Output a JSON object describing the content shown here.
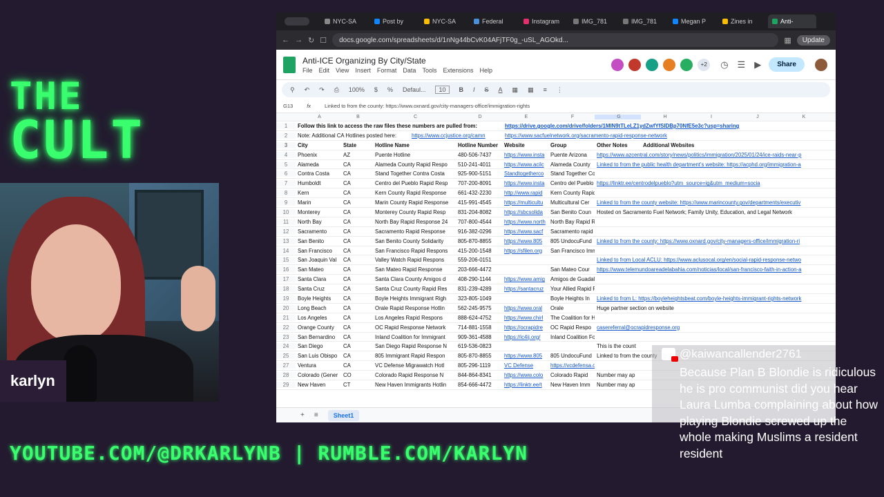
{
  "overlay": {
    "title_line1": "THE",
    "title_line2": "CULT",
    "streamer_name": "karlyn",
    "footer": "YOUTUBE.COM/@DRKARLYNB | RUMBLE.COM/KARLYN",
    "accent_color": "#39ff6e"
  },
  "browser": {
    "tabs": [
      "NYC-SA",
      "Post by",
      "NYC-SA",
      "Federal",
      "Instagram",
      "IMG_781",
      "IMG_781",
      "Megan P",
      "Zines in",
      "Anti-"
    ],
    "url": "docs.google.com/spreadsheets/d/1nNg44bCvK04AFjTF0g_-uSL_AGOkd...",
    "update_label": "Update"
  },
  "sheet": {
    "doc_title": "Anti-ICE Organizing By City/State",
    "menus": [
      "File",
      "Edit",
      "View",
      "Insert",
      "Format",
      "Data",
      "Tools",
      "Extensions",
      "Help"
    ],
    "share_label": "Share",
    "avatar_more": "+2",
    "zoom": "100%",
    "font": "Defaul...",
    "font_size": "10",
    "cell_ref": "G13",
    "formula": "Linked to from the county: https://www.oxnard.gov/city-managers-office/immigration-rights",
    "columns": [
      "A",
      "B",
      "C",
      "D",
      "E",
      "F",
      "G",
      "H",
      "I",
      "J",
      "K"
    ],
    "row1_text": "Follow this link to access the raw files these numbers are pulled from:",
    "row1_link": "https://drive.google.com/drive/folders/1MlN9tTLeLZ1ydZwfYfSIDBp70NfE5e3c?usp=sharing",
    "row2_text": "Note: Additional CA Hotlines posted here:",
    "row2_link1": "https://www.ccjustice.org/camn",
    "row2_link2": "https://www.sacfuelnetwork.org/sacramento-rapid-response-network",
    "headers": [
      "City",
      "State",
      "Hotline Name",
      "Hotline Number",
      "Website",
      "Group",
      "Other Notes",
      "Additional Websites"
    ],
    "rows": [
      [
        "4",
        "Phoenix",
        "AZ",
        "Puente Hotline",
        "480-506-7437",
        "https://www.insta",
        "Puente Arizona",
        "https://www.azcentral.com/story/news/politics/immigration/2025/01/24/ice-raids-near-p"
      ],
      [
        "5",
        "Alameda",
        "CA",
        "Alameda County Rapid Respo",
        "510-241-4011",
        "https://www.acilc",
        "Alameda County",
        "Linked to from the public health department's website: https://acphd.org/immigration-a"
      ],
      [
        "6",
        "Contra Costa",
        "CA",
        "Stand Together Contra Costa",
        "925-900-5151",
        "Standtogetherco",
        "Stand Together Costa County Public Defenders",
        ""
      ],
      [
        "7",
        "Humboldt",
        "CA",
        "Centro del Pueblo Rapid Resp",
        "707-200-8091",
        "https://www.insta",
        "Centro del Pueblo Rapid Respon",
        "https://linktr.ee/centrodelpueblo?utm_source=ig&utm_medium=socia"
      ],
      [
        "8",
        "Kern",
        "CA",
        "Kern County Rapid Response",
        "661-432-2230",
        "http://www.rapid",
        "Kern County Rapid Response Network of Kern",
        ""
      ],
      [
        "9",
        "Marin",
        "CA",
        "Marin County Rapid Response",
        "415-991-4545",
        "https://multicultu",
        "Multicultural Cer",
        "Linked to from the county website: https://www.marincounty.gov/departments/executiv"
      ],
      [
        "10",
        "Monterey",
        "CA",
        "Monterey County Rapid Resp",
        "831-204-8082",
        "https://sbcsolida",
        "San Benito Coun",
        "Hosted on Sacramento Fuel Network; Family Unity, Education, and Legal Network"
      ],
      [
        "11",
        "North Bay",
        "CA",
        "North Bay Rapid Response 24",
        "707-800-4544",
        "https://www.north",
        "North Bay Rapid Response Network",
        ""
      ],
      [
        "12",
        "Sacramento",
        "CA",
        "Sacramento Rapid Response",
        "916-382-0296",
        "https://www.sacf",
        "Sacramento rapid response network",
        ""
      ],
      [
        "13",
        "San Benito",
        "CA",
        "San Benito County Solidarity",
        "805-870-8855",
        "https://www.805",
        "805 UndocuFund",
        "Linked to from the county: https://www.oxnard.gov/city-managers-office/immigration-ri"
      ],
      [
        "14",
        "San Francisco",
        "CA",
        "San Francisco Rapid Respons",
        "415-200-1548",
        "https://sfilen.org",
        "San Francisco Immigrant Legal & Education Network",
        ""
      ],
      [
        "15",
        "San Joaquin Val",
        "CA",
        "Valley Watch Rapid Respons",
        "559-206-0151",
        "",
        "",
        "Linked to from Local ACLU: https://www.aclusocal.org/en/social-rapid-response-netwo"
      ],
      [
        "16",
        "San Mateo",
        "CA",
        "San Mateo Rapid Response",
        "203-666-4472",
        "",
        "San Mateo Cour",
        "https://www.telemundoareadelabahia.com/noticias/local/san-francisco-faith-in-action-a"
      ],
      [
        "17",
        "Santa Clara",
        "CA",
        "Santa Clara County Amigos d",
        "408-290-1144",
        "https://www.amig",
        "Amigos de Guadalupe Center for Justice & Empowerment",
        ""
      ],
      [
        "18",
        "Santa Cruz",
        "CA",
        "Santa Cruz County Rapid Res",
        "831-239-4289",
        "https://santacruz",
        "Your Allied Rapid Response for Santa Cruz County",
        ""
      ],
      [
        "19",
        "Boyle Heights",
        "CA",
        "Boyle Heights Immigrant Righ",
        "323-805-1049",
        "",
        "Boyle Heights In",
        "Linked to from L: https://boyleheightsbeat.com/boyle-heights-immigrant-rights-network"
      ],
      [
        "20",
        "Long Beach",
        "CA",
        "Orale Rapid Response Hotlin",
        "562-245-9575",
        "https://www.oral",
        "Orale",
        "Huge partner section on website"
      ],
      [
        "21",
        "Los Angeles",
        "CA",
        "Los Angeles Rapid Respons",
        "888-624-4752",
        "https://www.chirl",
        "The Coalition for Humane Immigrant Rights",
        ""
      ],
      [
        "22",
        "Orange County",
        "CA",
        "OC Rapid Response Network",
        "714-881-1558",
        "https://ocrapidre",
        "OC Rapid Respo",
        "casereferral@ocrapidresponse.org"
      ],
      [
        "23",
        "San Bernardino",
        "CA",
        "Inland Coalition for Immigrant",
        "909-361-4588",
        "https://ic4ij.org/",
        "Inland Coalition For Immigrant Justice - Emergency Response Network (San Bernardino & Riverside C",
        ""
      ],
      [
        "24",
        "San Diego",
        "CA",
        "San Diego Rapid Response N",
        "619-536-0823",
        "",
        "",
        "This is the count"
      ],
      [
        "25",
        "San Luis Obispo",
        "CA",
        "805 Immigrant Rapid Respon",
        "805-870-8855",
        "https://www.805",
        "805 UndocuFund",
        "Linked to from the county"
      ],
      [
        "27",
        "Ventura",
        "CA",
        "VC Defense Migrawatch Hotl",
        "805-296-1119",
        "VC Defense",
        "https://vcdefensa.org/",
        ""
      ],
      [
        "28",
        "Colorado (Gener",
        "CO",
        "Colorado Rapid Response N",
        "844-864-8341",
        "https://www.colo",
        "Colorado Rapid",
        "Number may ap"
      ],
      [
        "29",
        "New Haven",
        "CT",
        "New Haven Immigrants Hotlin",
        "854-666-4472",
        "https://linktr.ee/t",
        "New Haven Imm",
        "Number may ap"
      ]
    ],
    "sheet_tab": "Sheet1"
  },
  "chat": {
    "username": "@kaiwancallender2761",
    "message": "Because Plan B Blondie is ridiculous he is pro communist did you hear Laura Lumba complaining about how playing Blondie screwed up the whole making Muslims a resident resident"
  }
}
